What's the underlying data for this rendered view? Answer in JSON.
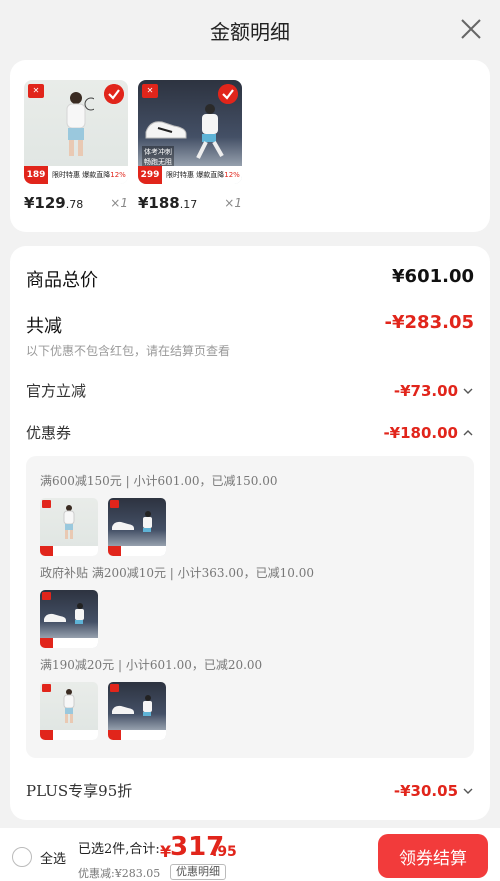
{
  "header": {
    "title": "金额明细"
  },
  "products": [
    {
      "price_int": "¥129",
      "price_dec": ".78",
      "qty": "×1",
      "promo_tag": "189",
      "promo_text": "限时特惠 爆款直降",
      "promo_pct": "12%"
    },
    {
      "price_int": "¥188",
      "price_dec": ".17",
      "qty": "×1",
      "promo_tag": "299",
      "promo_text": "限时特惠 爆款直降",
      "promo_pct": "12%",
      "overlay": "体考冲刺\n畅跑无阻"
    }
  ],
  "detail": {
    "total_label": "商品总价",
    "total_value": "¥601.00",
    "discount_label": "共减",
    "discount_value": "-¥283.05",
    "discount_note": "以下优惠不包含红包，请在结算页查看",
    "official_label": "官方立减",
    "official_value": "-¥73.00",
    "coupon_label": "优惠券",
    "coupon_value": "-¥180.00",
    "coupon_lines": [
      "满600减150元 | 小计601.00，已减150.00",
      "政府补贴 满200减10元 | 小计363.00，已减10.00",
      "满190减20元 | 小计601.00，已减20.00"
    ],
    "plus_label": "PLUS专享95折",
    "plus_value": "-¥30.05"
  },
  "bottom": {
    "select_all": "全选",
    "summary": "已选2件,合计:",
    "currency": "¥",
    "total_int": "317",
    "total_dec": ".95",
    "discount": "优惠减:¥283.05",
    "detail_button": "优惠明细",
    "checkout_button": "领券结算"
  },
  "colors": {
    "accent_red": "#e1251b",
    "button_red": "#f23b3b"
  }
}
